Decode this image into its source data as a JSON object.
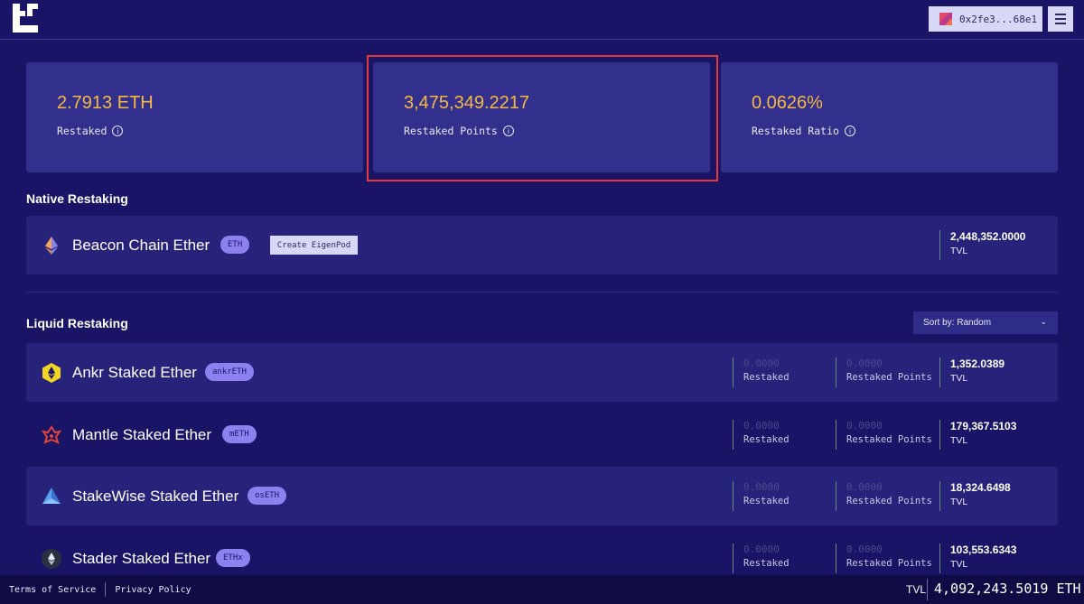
{
  "header": {
    "wallet_address": "0x2fe3...68e1"
  },
  "stats": [
    {
      "value": "2.7913 ETH",
      "label": "Restaked"
    },
    {
      "value": "3,475,349.2217",
      "label": "Restaked Points"
    },
    {
      "value": "0.0626%",
      "label": "Restaked Ratio"
    }
  ],
  "native": {
    "title": "Native Restaking",
    "token": {
      "name": "Beacon Chain Ether",
      "symbol": "ETH",
      "tvl": "2,448,352.0000",
      "tvl_label": "TVL"
    },
    "create_button": "Create EigenPod"
  },
  "liquid": {
    "title": "Liquid Restaking",
    "sort_label": "Sort by: Random",
    "tokens": [
      {
        "name": "Ankr Staked Ether",
        "symbol": "ankrETH",
        "restaked": "0.0000",
        "restaked_label": "Restaked",
        "points": "0.0000",
        "points_label": "Restaked Points",
        "tvl": "1,352.0389",
        "tvl_label": "TVL"
      },
      {
        "name": "Mantle Staked Ether",
        "symbol": "mETH",
        "restaked": "0.0000",
        "restaked_label": "Restaked",
        "points": "0.0000",
        "points_label": "Restaked Points",
        "tvl": "179,367.5103",
        "tvl_label": "TVL"
      },
      {
        "name": "StakeWise Staked Ether",
        "symbol": "osETH",
        "restaked": "0.0000",
        "restaked_label": "Restaked",
        "points": "0.0000",
        "points_label": "Restaked Points",
        "tvl": "18,324.6498",
        "tvl_label": "TVL"
      },
      {
        "name": "Stader Staked Ether",
        "symbol": "ETHx",
        "restaked": "0.0000",
        "restaked_label": "Restaked",
        "points": "0.0000",
        "points_label": "Restaked Points",
        "tvl": "103,553.6343",
        "tvl_label": "TVL"
      }
    ]
  },
  "footer": {
    "terms": "Terms of Service",
    "privacy": "Privacy Policy",
    "tvl_label": "TVL",
    "tvl_value": "4,092,243.5019 ETH"
  },
  "colors": {
    "background": "#1a1466",
    "card": "#33308d",
    "accent": "#f4b942",
    "highlight_border": "#e53935"
  }
}
